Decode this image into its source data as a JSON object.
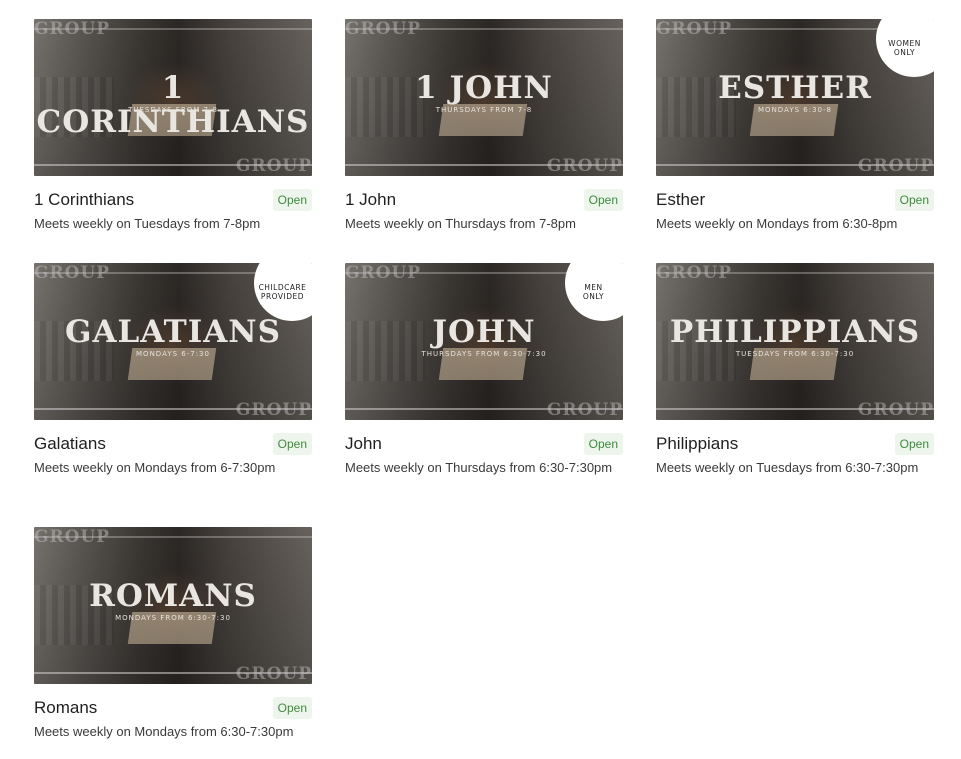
{
  "groups": [
    {
      "name": "1 Corinthians",
      "image_title": "1 CORINTHIANS",
      "image_subtitle": "TUESDAYS FROM 7-8",
      "badge": "",
      "status": "Open",
      "description": "Meets weekly on Tuesdays from 7-8pm"
    },
    {
      "name": "1 John",
      "image_title": "1 JOHN",
      "image_subtitle": "THURSDAYS FROM 7-8",
      "badge": "",
      "status": "Open",
      "description": "Meets weekly on Thursdays from 7-8pm"
    },
    {
      "name": "Esther",
      "image_title": "ESTHER",
      "image_subtitle": "MONDAYS 6:30-8",
      "badge": "WOMEN\nONLY",
      "status": "Open",
      "description": "Meets weekly on Mondays from 6:30-8pm"
    },
    {
      "name": "Galatians",
      "image_title": "GALATIANS",
      "image_subtitle": "MONDAYS 6-7:30",
      "badge": "CHILDCARE\nPROVIDED",
      "status": "Open",
      "description": "Meets weekly on Mondays from 6-7:30pm"
    },
    {
      "name": "John",
      "image_title": "JOHN",
      "image_subtitle": "THURSDAYS FROM 6:30-7:30",
      "badge": "MEN\nONLY",
      "status": "Open",
      "description": "Meets weekly on Thursdays from 6:30-7:30pm"
    },
    {
      "name": "Philippians",
      "image_title": "PHILIPPIANS",
      "image_subtitle": "TUESDAYS FROM 6:30-7:30",
      "badge": "",
      "status": "Open",
      "description": "Meets weekly on Tuesdays from 6:30-7:30pm"
    },
    {
      "name": "Romans",
      "image_title": "ROMANS",
      "image_subtitle": "MONDAYS FROM 6:30-7:30",
      "badge": "",
      "status": "Open",
      "description": "Meets weekly on Mondays from 6:30-7:30pm"
    }
  ],
  "image_watermark": "GROUP",
  "colors": {
    "status_bg": "#eef5ec",
    "status_text": "#3f8a3f"
  }
}
